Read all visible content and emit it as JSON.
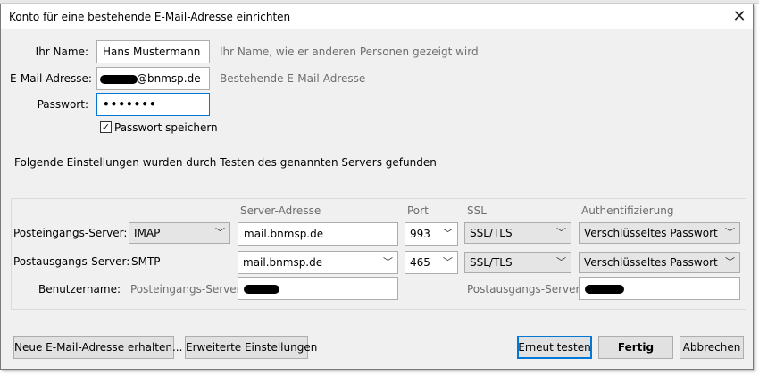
{
  "window": {
    "title": "Konto für eine bestehende E-Mail-Adresse einrichten",
    "close_glyph": "✕"
  },
  "form": {
    "name_label": "Ihr Name:",
    "name_value": "Hans Mustermann",
    "name_hint": "Ihr Name, wie er anderen Personen gezeigt wird",
    "email_label": "E-Mail-Adresse:",
    "email_value": "@bnmsp.de",
    "email_hint": "Bestehende E-Mail-Adresse",
    "password_label": "Passwort:",
    "password_value": "•••••••",
    "remember_label": "Passwort speichern",
    "remember_checked": true
  },
  "status_text": "Folgende Einstellungen wurden durch Testen des genannten Servers gefunden",
  "servers": {
    "headers": {
      "address": "Server-Adresse",
      "port": "Port",
      "ssl": "SSL",
      "auth": "Authentifizierung"
    },
    "incoming": {
      "label": "Posteingangs-Server:",
      "protocol": "IMAP",
      "address": "mail.bnmsp.de",
      "port": "993",
      "ssl": "SSL/TLS",
      "auth": "Verschlüsseltes Passwort"
    },
    "outgoing": {
      "label": "Postausgangs-Server:",
      "protocol": "SMTP",
      "address": "mail.bnmsp.de",
      "port": "465",
      "ssl": "SSL/TLS",
      "auth": "Verschlüsseltes Passwort"
    },
    "username": {
      "label": "Benutzername:",
      "incoming_label": "Posteingangs-Server:",
      "outgoing_label": "Postausgangs-Server:"
    }
  },
  "buttons": {
    "new_address": "Neue E-Mail-Adresse erhalten...",
    "advanced": "Erweiterte Einstellungen",
    "retest": "Erneut testen",
    "done": "Fertig",
    "cancel": "Abbrechen"
  },
  "icons": {
    "dropdown": "chevron-down-icon",
    "close": "close-icon",
    "check": "checkmark-icon"
  },
  "colors": {
    "focus_border": "#0078d7",
    "dialog_bg": "#f0f0f0",
    "hint_text": "#6d6d6d"
  }
}
